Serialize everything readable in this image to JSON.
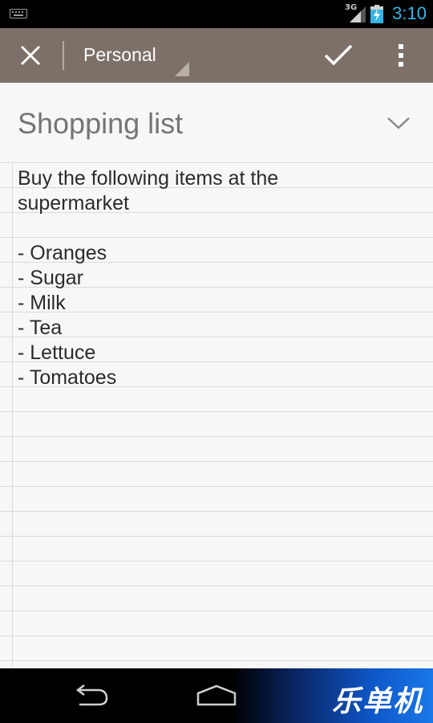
{
  "status_bar": {
    "network_type": "3G",
    "time": "3:10",
    "icons": [
      "keyboard-icon",
      "signal-icon",
      "battery-charging-icon"
    ],
    "clock_color": "#33b5e5"
  },
  "action_bar": {
    "folder_label": "Personal",
    "icons": [
      "close-icon",
      "checkmark-icon",
      "overflow-menu-icon"
    ],
    "background_color": "#7c7068"
  },
  "note": {
    "title_placeholder": "Shopping list",
    "body": "Buy the following items at the\nsupermarket\n\n- Oranges\n- Sugar\n- Milk\n- Tea\n- Lettuce\n- Tomatoes",
    "expand_icon": "chevron-down-icon"
  },
  "nav_bar": {
    "icons": [
      "back-icon",
      "home-icon"
    ],
    "watermark": "乐单机"
  }
}
